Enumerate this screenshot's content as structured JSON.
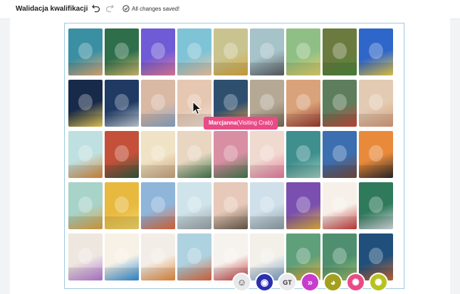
{
  "toolbar": {
    "title": "Walidacja kwalifikacji",
    "undo_icon": "undo-icon",
    "redo_icon": "redo-icon",
    "status_icon": "check-circle-icon",
    "status": "All changes saved!"
  },
  "grid": {
    "columns": 9,
    "rows": 5,
    "tiles": [
      {
        "bg": "#3b8fa3",
        "fg": "#e8b07a"
      },
      {
        "bg": "#2f6e4b",
        "fg": "#d9c071"
      },
      {
        "bg": "#6f5bd6",
        "fg": "#e77da0"
      },
      {
        "bg": "#7fc3d6",
        "fg": "#f4c9a3"
      },
      {
        "bg": "#c9c48f",
        "fg": "#d9a83a"
      },
      {
        "bg": "#a6c3c9",
        "fg": "#5b5e62"
      },
      {
        "bg": "#8fbf84",
        "fg": "#e6d36a"
      },
      {
        "bg": "#6b7a3e",
        "fg": "#4b8a3c"
      },
      {
        "bg": "#2f66c9",
        "fg": "#f2d14b"
      },
      {
        "bg": "#182a4a",
        "fg": "#f1d25a"
      },
      {
        "bg": "#1f3a63",
        "fg": "#c9d3e0"
      },
      {
        "bg": "#d9b9a4",
        "fg": "#8ba7c9"
      },
      {
        "bg": "#e6c7b1",
        "fg": "#f3e2d4"
      },
      {
        "bg": "#2f4f6f",
        "fg": "#e9a24a"
      },
      {
        "bg": "#b5a996",
        "fg": "#7d6a57"
      },
      {
        "bg": "#d9a27a",
        "fg": "#9d3a2f"
      },
      {
        "bg": "#5e7d5c",
        "fg": "#c94a3b"
      },
      {
        "bg": "#e2cbb2",
        "fg": "#d99c7a"
      },
      {
        "bg": "#bfe0e0",
        "fg": "#d98a3a"
      },
      {
        "bg": "#c4503a",
        "fg": "#2f5a3e"
      },
      {
        "bg": "#f0e2c4",
        "fg": "#c9a27a"
      },
      {
        "bg": "#e8d6c1",
        "fg": "#3f7a4a"
      },
      {
        "bg": "#d98fa3",
        "fg": "#3f7a4a"
      },
      {
        "bg": "#f0d9cf",
        "fg": "#e87aa0"
      },
      {
        "bg": "#3f8f8f",
        "fg": "#9fd1c0"
      },
      {
        "bg": "#3b6fb0",
        "fg": "#7a4a3a"
      },
      {
        "bg": "#e98a3b",
        "fg": "#2a2a2a"
      },
      {
        "bg": "#a7d3c9",
        "fg": "#e1a33b"
      },
      {
        "bg": "#e8b93f",
        "fg": "#f2d86b"
      },
      {
        "bg": "#8fb5d9",
        "fg": "#e66a3b"
      },
      {
        "bg": "#cfe3ea",
        "fg": "#9aa3a8"
      },
      {
        "bg": "#e6c9b8",
        "fg": "#6a5a4a"
      },
      {
        "bg": "#cfe0ea",
        "fg": "#8d9da6"
      },
      {
        "bg": "#7a4fb0",
        "fg": "#e6b33b"
      },
      {
        "bg": "#f6f0e8",
        "fg": "#c93b3b"
      },
      {
        "bg": "#2f7a5b",
        "fg": "#d9dde3"
      },
      {
        "bg": "#ede7df",
        "fg": "#b87ad9"
      },
      {
        "bg": "#f7f1e6",
        "fg": "#2f8fd9"
      },
      {
        "bg": "#f2eee7",
        "fg": "#e98a3b"
      },
      {
        "bg": "#aed2e0",
        "fg": "#e0693b"
      },
      {
        "bg": "#f6f2ee",
        "fg": "#c93b3b"
      },
      {
        "bg": "#f3f0ea",
        "fg": "#7aa3c9"
      },
      {
        "bg": "#5f9f7a",
        "fg": "#e9b63b"
      },
      {
        "bg": "#4f8f6f",
        "fg": "#9fbf6a"
      },
      {
        "bg": "#1f4f7a",
        "fg": "#c96a3b"
      }
    ]
  },
  "tooltip": {
    "name": "Marcjanna",
    "detail": "(Visiting Crab)",
    "color": "#e94b86"
  },
  "collaborators": [
    {
      "icon": "smiling-face-icon",
      "bg": "#e9e9ec",
      "label": ""
    },
    {
      "icon": "astronaut-icon",
      "bg": "#2b2fb0",
      "label": ""
    },
    {
      "icon": "",
      "bg": "#e9e9ec",
      "label": "GT"
    },
    {
      "icon": "forward-arrows-icon",
      "bg": "#c93bcf",
      "label": ""
    },
    {
      "icon": "monkey-icon",
      "bg": "#a3a01f",
      "label": ""
    },
    {
      "icon": "crab-icon",
      "bg": "#e94b86",
      "label": ""
    },
    {
      "icon": "crab-icon",
      "bg": "#b8c21f",
      "label": ""
    }
  ]
}
